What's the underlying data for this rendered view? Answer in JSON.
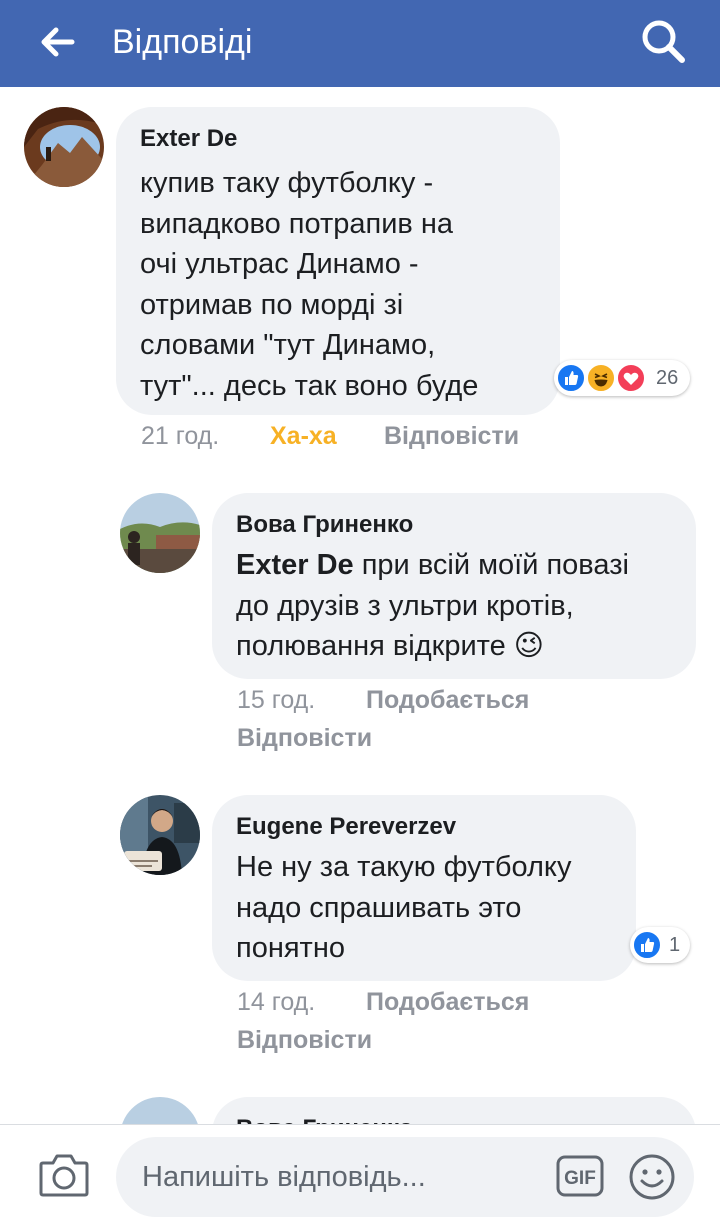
{
  "header": {
    "title": "Відповіді"
  },
  "comments": [
    {
      "author": "Exter De",
      "text_lines": [
        "купив таку футболку -",
        "випадково потрапив на",
        "очі ультрас Динамо -",
        "отримав по морді зі",
        "словами \"тут Динамо,",
        "тут\"... десь так воно буде"
      ],
      "time": "21 год.",
      "reaction_label": "Ха-ха",
      "reply_label": "Відповісти",
      "reactions": {
        "icons": [
          "like-icon",
          "haha-icon",
          "love-icon"
        ],
        "count": "26"
      }
    },
    {
      "author": "Вова Гриненко",
      "mention": "Exter De",
      "text_lines": [
        " при всій моїй повазі",
        "до друзів з ультри кротів,",
        "полювання відкрите 😉"
      ],
      "time": "15 год.",
      "like_label": "Подобається",
      "reply_label": "Відповісти"
    },
    {
      "author": "Eugene Pereverzev",
      "text_lines": [
        "Не ну за такую футболку",
        "надо спрашивать это",
        "понятно"
      ],
      "time": "14 год.",
      "like_label": "Подобається",
      "reply_label": "Відповісти",
      "reactions": {
        "icons": [
          "like-icon"
        ],
        "count": "1"
      }
    },
    {
      "author": "Вова Гриненко"
    }
  ],
  "composer": {
    "placeholder": "Напишіть відповідь...",
    "gif_label": "GIF"
  },
  "colors": {
    "brand": "#4267b2",
    "bubble": "#f0f2f5",
    "meta": "#90949c",
    "haha": "#f7b125",
    "love": "#f33e58"
  }
}
